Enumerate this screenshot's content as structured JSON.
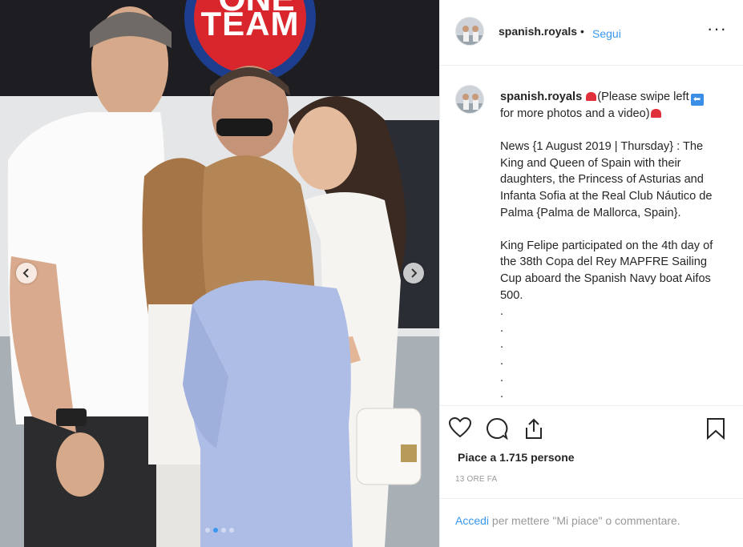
{
  "photo": {
    "banner_top": "ONE",
    "banner_text": "TEAM"
  },
  "header": {
    "username": "spanish.royals",
    "separator": "•",
    "follow_label": "Segui",
    "more_label": "···"
  },
  "caption": {
    "username": "spanish.royals",
    "intro_text": "(Please swipe left",
    "intro_text_2": "for more photos and a video)",
    "body": "News {1 August 2019 | Thursday} : The King and Queen of Spain with their daughters, the Princess of Asturias and Infanta Sofia at the Real Club Náutico de Palma {Palma de Mallorca, Spain}.\n\nKing Felipe participated on the 4th day of the 38th Copa del Rey MAPFRE Sailing Cup aboard the Spanish Navy boat Aifos 500.\n.\n.\n.\n.\n.\n."
  },
  "actions": {
    "likes_text": "Piace a 1.715 persone",
    "timestamp": "13 ORE FA",
    "icons": [
      "heart-icon",
      "comment-icon",
      "share-icon",
      "bookmark-icon"
    ]
  },
  "login": {
    "link_label": "Accedi",
    "rest_text": " per mettere \"Mi piace\" o commentare."
  },
  "colors": {
    "link_blue": "#3897f0",
    "text": "#262626",
    "muted": "#999999"
  }
}
